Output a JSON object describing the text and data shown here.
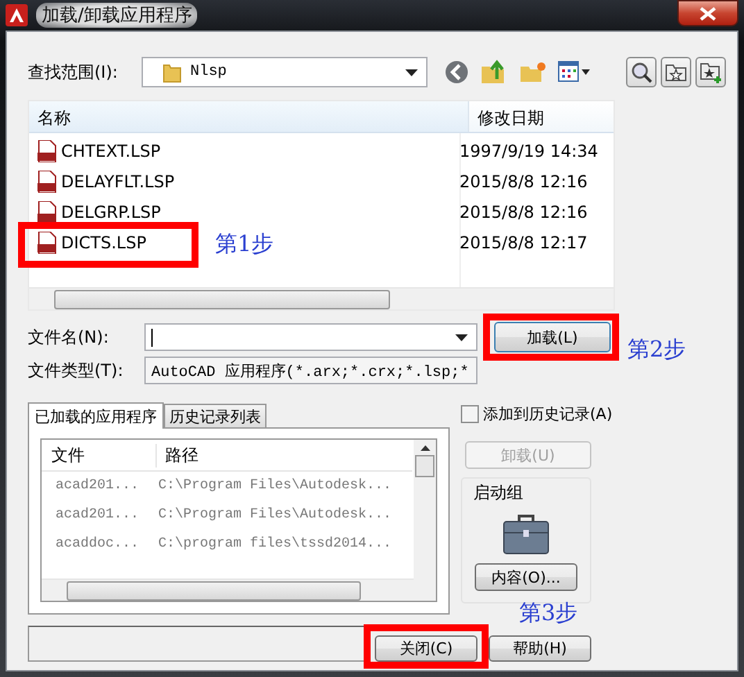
{
  "window": {
    "title": "加载/卸载应用程序"
  },
  "look_in": {
    "label": "查找范围(I):",
    "value": "Nlsp"
  },
  "file_list": {
    "columns": [
      "名称",
      "修改日期"
    ],
    "rows": [
      {
        "name": "CHTEXT.LSP",
        "modified": "1997/9/19 14:34"
      },
      {
        "name": "DELAYFLT.LSP",
        "modified": "2015/8/8 12:16"
      },
      {
        "name": "DELGRP.LSP",
        "modified": "2015/8/8 12:16"
      },
      {
        "name": "DICTS.LSP",
        "modified": "2015/8/8 12:17"
      }
    ]
  },
  "file_name": {
    "label": "文件名(N):"
  },
  "file_type": {
    "label": "文件类型(T):",
    "value": "AutoCAD 应用程序(*.arx;*.crx;*.lsp;*"
  },
  "load_button": "加载(L)",
  "tabs": [
    {
      "label": "已加载的应用程序",
      "selected": true
    },
    {
      "label": "历史记录列表",
      "selected": false
    }
  ],
  "loaded_apps": {
    "columns": [
      "文件",
      "路径"
    ],
    "rows": [
      {
        "file": "acad201...",
        "path": "C:\\Program Files\\Autodesk..."
      },
      {
        "file": "acad201...",
        "path": "C:\\Program Files\\Autodesk..."
      },
      {
        "file": "acaddoc...",
        "path": "C:\\program files\\tssd2014..."
      }
    ]
  },
  "add_to_history": {
    "label": "添加到历史记录(A)",
    "checked": false
  },
  "unload_button": {
    "label": "卸载(U)",
    "disabled": true
  },
  "startup_group": {
    "label": "启动组",
    "contents_button": "内容(O)..."
  },
  "close_button": "关闭(C)",
  "help_button": "帮助(H)",
  "annotations": [
    {
      "text": "第1步"
    },
    {
      "text": "第2步"
    },
    {
      "text": "第3步"
    }
  ]
}
